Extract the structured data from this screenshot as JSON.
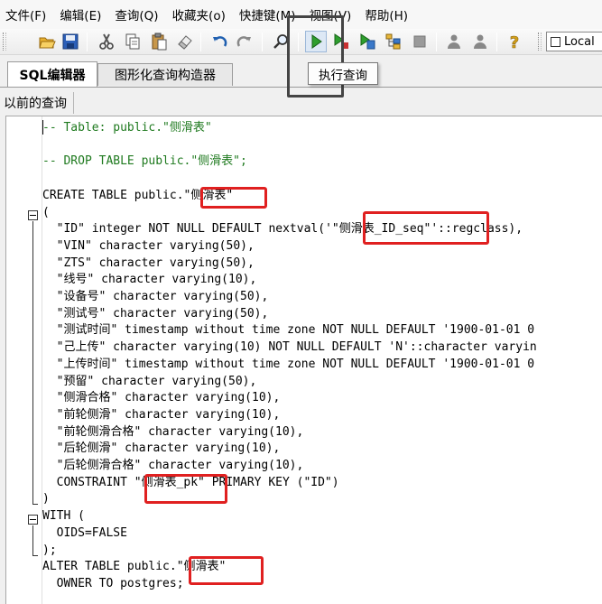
{
  "menu": [
    "文件(F)",
    "编辑(E)",
    "查询(Q)",
    "收藏夹(o)",
    "快捷键(M)",
    "视图(V)",
    "帮助(H)"
  ],
  "toolbar": {
    "buttons": [
      {
        "name": "open-file-button",
        "icon": "folder-open-icon"
      },
      {
        "name": "save-file-button",
        "icon": "save-icon"
      },
      {
        "name": "cut-button",
        "icon": "cut-icon"
      },
      {
        "name": "copy-button",
        "icon": "copy-icon"
      },
      {
        "name": "paste-button",
        "icon": "paste-icon"
      },
      {
        "name": "clear-button",
        "icon": "eraser-icon"
      },
      {
        "name": "undo-button",
        "icon": "undo-icon"
      },
      {
        "name": "redo-button",
        "icon": "redo-icon"
      },
      {
        "name": "find-button",
        "icon": "search-icon"
      },
      {
        "name": "execute-query-button",
        "icon": "play-icon"
      },
      {
        "name": "execute-to-file-button",
        "icon": "play-to-file-icon"
      },
      {
        "name": "execute-pgscript-button",
        "icon": "play-script-icon"
      },
      {
        "name": "explain-button",
        "icon": "explain-icon"
      },
      {
        "name": "cancel-query-button",
        "icon": "stop-icon"
      },
      {
        "name": "macro-button-1",
        "icon": "person-icon"
      },
      {
        "name": "macro-button-2",
        "icon": "person-icon"
      },
      {
        "name": "help-button",
        "icon": "help-icon"
      }
    ],
    "server_label": "Local",
    "tooltip": "执行查询"
  },
  "tabs": [
    {
      "label": "SQL编辑器",
      "active": true
    },
    {
      "label": "图形化查询构造器",
      "active": false
    }
  ],
  "previous_queries_label": "以前的查询",
  "code_lines": [
    "-- Table: public.\"侧滑表\"",
    "",
    "-- DROP TABLE public.\"侧滑表\";",
    "",
    "CREATE TABLE public.\"侧滑表\"",
    "(",
    "  \"ID\" integer NOT NULL DEFAULT nextval('\"侧滑表_ID_seq\"'::regclass),",
    "  \"VIN\" character varying(50),",
    "  \"ZTS\" character varying(50),",
    "  \"线号\" character varying(10),",
    "  \"设备号\" character varying(50),",
    "  \"测试号\" character varying(50),",
    "  \"测试时间\" timestamp without time zone NOT NULL DEFAULT '1900-01-01 0",
    "  \"己上传\" character varying(10) NOT NULL DEFAULT 'N'::character varyin",
    "  \"上传时间\" timestamp without time zone NOT NULL DEFAULT '1900-01-01 0",
    "  \"预留\" character varying(50),",
    "  \"侧滑合格\" character varying(10),",
    "  \"前轮侧滑\" character varying(10),",
    "  \"前轮侧滑合格\" character varying(10),",
    "  \"后轮侧滑\" character varying(10),",
    "  \"后轮侧滑合格\" character varying(10),",
    "  CONSTRAINT \"侧滑表_pk\" PRIMARY KEY (\"ID\")",
    ")",
    "WITH (",
    "  OIDS=FALSE",
    ");",
    "ALTER TABLE public.\"侧滑表\"",
    "  OWNER TO postgres;"
  ]
}
